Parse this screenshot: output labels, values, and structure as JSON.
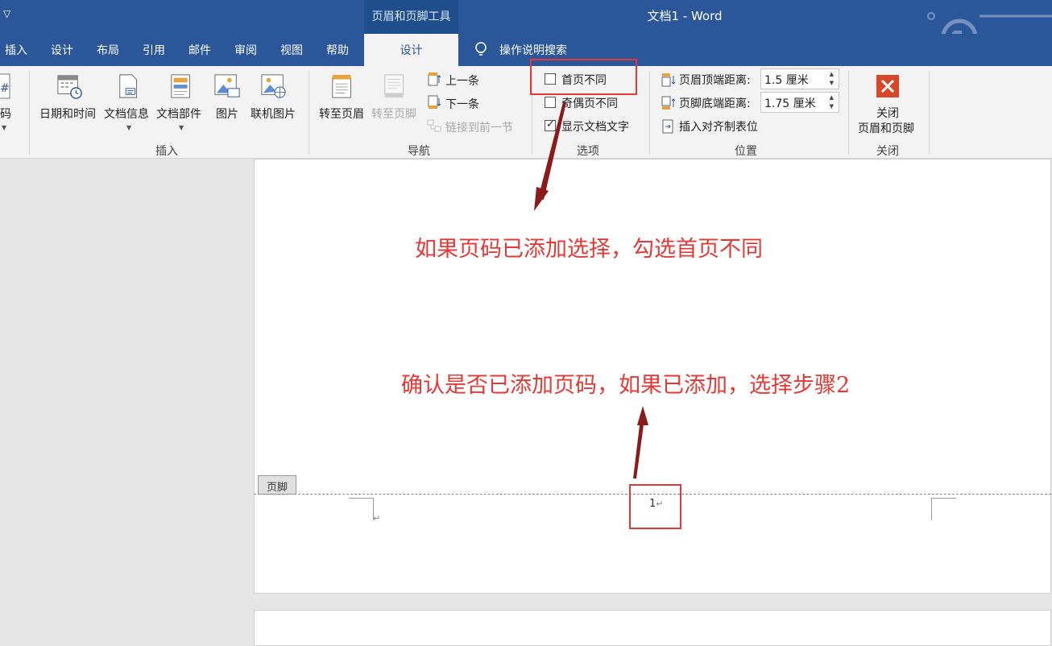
{
  "titlebar": {
    "context_tool": "页眉和页脚工具",
    "doc_title": "文档1  -  Word"
  },
  "tabs": {
    "insert": "插入",
    "design_main": "设计",
    "layout": "布局",
    "references": "引用",
    "mailings": "邮件",
    "review": "审阅",
    "view": "视图",
    "help": "帮助",
    "design_active": "设计",
    "search": "操作说明搜索"
  },
  "ribbon": {
    "page_number_partial": "码",
    "insert_group": {
      "date_time": "日期和时间",
      "doc_info": "文档信息",
      "doc_parts": "文档部件",
      "picture": "图片",
      "online_picture": "联机图片",
      "label": "插入"
    },
    "nav_group": {
      "goto_header": "转至页眉",
      "goto_footer": "转至页脚",
      "previous": "上一条",
      "next": "下一条",
      "link_previous": "链接到前一节",
      "label": "导航"
    },
    "options_group": {
      "different_first": "首页不同",
      "different_odd_even": "奇偶页不同",
      "show_doc_text": "显示文档文字",
      "different_first_checked": false,
      "different_odd_even_checked": false,
      "show_doc_text_checked": true,
      "label": "选项"
    },
    "position_group": {
      "header_top": "页眉顶端距离:",
      "header_top_value": "1.5 厘米",
      "footer_bottom": "页脚底端距离:",
      "footer_bottom_value": "1.75 厘米",
      "insert_align_tab": "插入对齐制表位",
      "label": "位置"
    },
    "close_group": {
      "close_line1": "关闭",
      "close_line2": "页眉和页脚",
      "label": "关闭"
    }
  },
  "document": {
    "annotation_top": "如果页码已添加选择，勾选首页不同",
    "annotation_bottom": "确认是否已添加页码，如果已添加，选择步骤2",
    "footer_tag": "页脚",
    "page_number": "1",
    "return_mark": "↵"
  },
  "colors": {
    "titlebar": "#2b579a",
    "annotation": "#e53935",
    "arrow": "#8b1a1a",
    "close_icon": "#d9472b"
  }
}
